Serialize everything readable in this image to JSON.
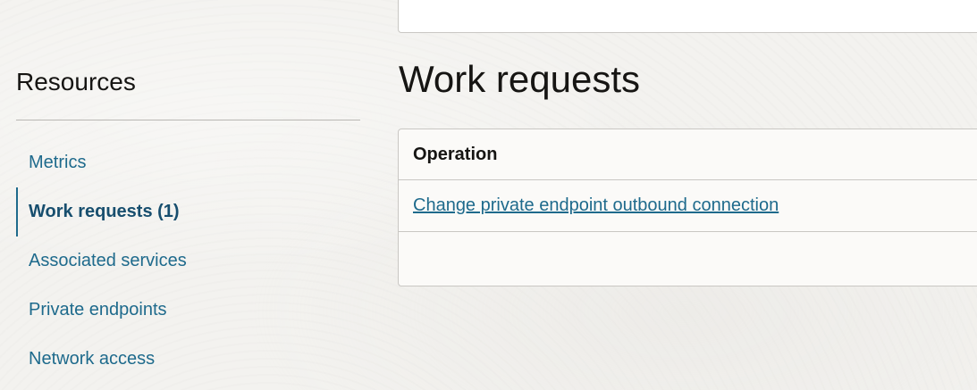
{
  "resources": {
    "title": "Resources",
    "items": [
      {
        "label": "Metrics",
        "active": false
      },
      {
        "label": "Work requests (1)",
        "active": true
      },
      {
        "label": "Associated services",
        "active": false
      },
      {
        "label": "Private endpoints",
        "active": false
      },
      {
        "label": "Network access",
        "active": false
      }
    ]
  },
  "main": {
    "title": "Work requests",
    "table": {
      "columns": [
        "Operation"
      ],
      "rows": [
        {
          "operation": "Change private endpoint outbound connection"
        }
      ]
    }
  },
  "colors": {
    "link": "#1e6a8c",
    "active_link": "#174e6e",
    "text": "#161513",
    "border": "#c9c7c3"
  }
}
